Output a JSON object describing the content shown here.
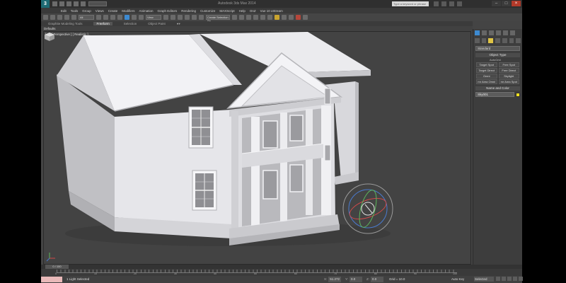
{
  "app": {
    "logo": "3",
    "title": "Autodesk 3ds Max 2014",
    "search_placeholder": "Type a keyword or phrase"
  },
  "menu": [
    "Edit",
    "Tools",
    "Group",
    "Views",
    "Create",
    "Modifiers",
    "Animation",
    "Graph Editors",
    "Rendering",
    "Customize",
    "MAXScript",
    "Help",
    "OnZ",
    "Vue 10 xStream"
  ],
  "toolbar": {
    "selection_filter": "All",
    "view_dropdown": "View",
    "named_selection": "Create Selection Se"
  },
  "ribbon": {
    "tabs": [
      "Graphite Modeling Tools",
      "Freeform",
      "Selection",
      "Object Paint"
    ],
    "active_tab": "Freeform",
    "panel_label": "Defaults"
  },
  "viewport": {
    "label": "[ + ] [ Perspective ] [ Realistic ]"
  },
  "command_panel": {
    "category_dropdown": "Standard",
    "object_type_header": "Object Type",
    "autogrid_label": "AutoGrid",
    "buttons": [
      "Target Spot",
      "Free Spot",
      "Target Direct",
      "Free Direct",
      "Omni",
      "Skylight",
      "mr Area Omni",
      "mr Area Spot"
    ],
    "name_color_header": "Name and Color",
    "name_value": "Sky001",
    "swatch_color": "#f1e020"
  },
  "timeline": {
    "slider_label": "0 / 100",
    "tick_labels": [
      "0",
      "10",
      "20",
      "30",
      "40",
      "50",
      "60",
      "70",
      "80",
      "90",
      "100"
    ]
  },
  "status": {
    "message": "1 Light Selected",
    "x_label": "X:",
    "x_value": "51.272",
    "y_label": "Y:",
    "y_value": "0.0",
    "z_label": "Z:",
    "z_value": "0.0",
    "grid_label": "Grid = 10.0",
    "autokey_label": "Auto Key",
    "key_filter": "Selected"
  }
}
